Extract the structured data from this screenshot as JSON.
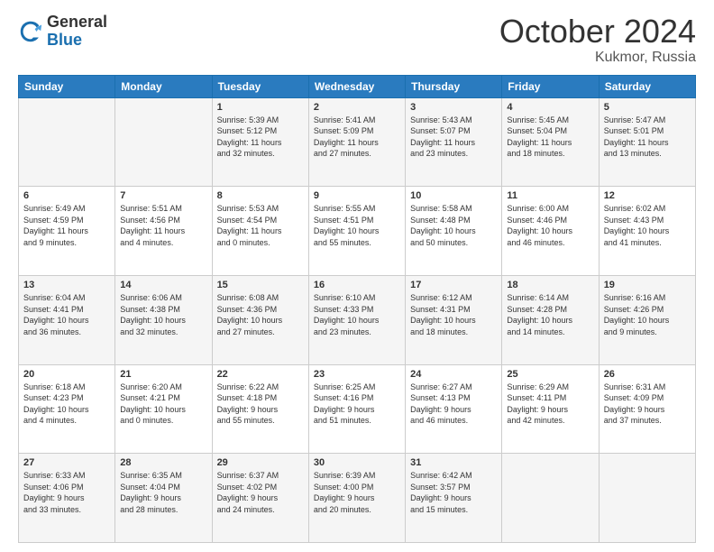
{
  "logo": {
    "general": "General",
    "blue": "Blue"
  },
  "title": "October 2024",
  "location": "Kukmor, Russia",
  "days_of_week": [
    "Sunday",
    "Monday",
    "Tuesday",
    "Wednesday",
    "Thursday",
    "Friday",
    "Saturday"
  ],
  "weeks": [
    [
      {
        "day": "",
        "info": ""
      },
      {
        "day": "",
        "info": ""
      },
      {
        "day": "1",
        "info": "Sunrise: 5:39 AM\nSunset: 5:12 PM\nDaylight: 11 hours\nand 32 minutes."
      },
      {
        "day": "2",
        "info": "Sunrise: 5:41 AM\nSunset: 5:09 PM\nDaylight: 11 hours\nand 27 minutes."
      },
      {
        "day": "3",
        "info": "Sunrise: 5:43 AM\nSunset: 5:07 PM\nDaylight: 11 hours\nand 23 minutes."
      },
      {
        "day": "4",
        "info": "Sunrise: 5:45 AM\nSunset: 5:04 PM\nDaylight: 11 hours\nand 18 minutes."
      },
      {
        "day": "5",
        "info": "Sunrise: 5:47 AM\nSunset: 5:01 PM\nDaylight: 11 hours\nand 13 minutes."
      }
    ],
    [
      {
        "day": "6",
        "info": "Sunrise: 5:49 AM\nSunset: 4:59 PM\nDaylight: 11 hours\nand 9 minutes."
      },
      {
        "day": "7",
        "info": "Sunrise: 5:51 AM\nSunset: 4:56 PM\nDaylight: 11 hours\nand 4 minutes."
      },
      {
        "day": "8",
        "info": "Sunrise: 5:53 AM\nSunset: 4:54 PM\nDaylight: 11 hours\nand 0 minutes."
      },
      {
        "day": "9",
        "info": "Sunrise: 5:55 AM\nSunset: 4:51 PM\nDaylight: 10 hours\nand 55 minutes."
      },
      {
        "day": "10",
        "info": "Sunrise: 5:58 AM\nSunset: 4:48 PM\nDaylight: 10 hours\nand 50 minutes."
      },
      {
        "day": "11",
        "info": "Sunrise: 6:00 AM\nSunset: 4:46 PM\nDaylight: 10 hours\nand 46 minutes."
      },
      {
        "day": "12",
        "info": "Sunrise: 6:02 AM\nSunset: 4:43 PM\nDaylight: 10 hours\nand 41 minutes."
      }
    ],
    [
      {
        "day": "13",
        "info": "Sunrise: 6:04 AM\nSunset: 4:41 PM\nDaylight: 10 hours\nand 36 minutes."
      },
      {
        "day": "14",
        "info": "Sunrise: 6:06 AM\nSunset: 4:38 PM\nDaylight: 10 hours\nand 32 minutes."
      },
      {
        "day": "15",
        "info": "Sunrise: 6:08 AM\nSunset: 4:36 PM\nDaylight: 10 hours\nand 27 minutes."
      },
      {
        "day": "16",
        "info": "Sunrise: 6:10 AM\nSunset: 4:33 PM\nDaylight: 10 hours\nand 23 minutes."
      },
      {
        "day": "17",
        "info": "Sunrise: 6:12 AM\nSunset: 4:31 PM\nDaylight: 10 hours\nand 18 minutes."
      },
      {
        "day": "18",
        "info": "Sunrise: 6:14 AM\nSunset: 4:28 PM\nDaylight: 10 hours\nand 14 minutes."
      },
      {
        "day": "19",
        "info": "Sunrise: 6:16 AM\nSunset: 4:26 PM\nDaylight: 10 hours\nand 9 minutes."
      }
    ],
    [
      {
        "day": "20",
        "info": "Sunrise: 6:18 AM\nSunset: 4:23 PM\nDaylight: 10 hours\nand 4 minutes."
      },
      {
        "day": "21",
        "info": "Sunrise: 6:20 AM\nSunset: 4:21 PM\nDaylight: 10 hours\nand 0 minutes."
      },
      {
        "day": "22",
        "info": "Sunrise: 6:22 AM\nSunset: 4:18 PM\nDaylight: 9 hours\nand 55 minutes."
      },
      {
        "day": "23",
        "info": "Sunrise: 6:25 AM\nSunset: 4:16 PM\nDaylight: 9 hours\nand 51 minutes."
      },
      {
        "day": "24",
        "info": "Sunrise: 6:27 AM\nSunset: 4:13 PM\nDaylight: 9 hours\nand 46 minutes."
      },
      {
        "day": "25",
        "info": "Sunrise: 6:29 AM\nSunset: 4:11 PM\nDaylight: 9 hours\nand 42 minutes."
      },
      {
        "day": "26",
        "info": "Sunrise: 6:31 AM\nSunset: 4:09 PM\nDaylight: 9 hours\nand 37 minutes."
      }
    ],
    [
      {
        "day": "27",
        "info": "Sunrise: 6:33 AM\nSunset: 4:06 PM\nDaylight: 9 hours\nand 33 minutes."
      },
      {
        "day": "28",
        "info": "Sunrise: 6:35 AM\nSunset: 4:04 PM\nDaylight: 9 hours\nand 28 minutes."
      },
      {
        "day": "29",
        "info": "Sunrise: 6:37 AM\nSunset: 4:02 PM\nDaylight: 9 hours\nand 24 minutes."
      },
      {
        "day": "30",
        "info": "Sunrise: 6:39 AM\nSunset: 4:00 PM\nDaylight: 9 hours\nand 20 minutes."
      },
      {
        "day": "31",
        "info": "Sunrise: 6:42 AM\nSunset: 3:57 PM\nDaylight: 9 hours\nand 15 minutes."
      },
      {
        "day": "",
        "info": ""
      },
      {
        "day": "",
        "info": ""
      }
    ]
  ]
}
